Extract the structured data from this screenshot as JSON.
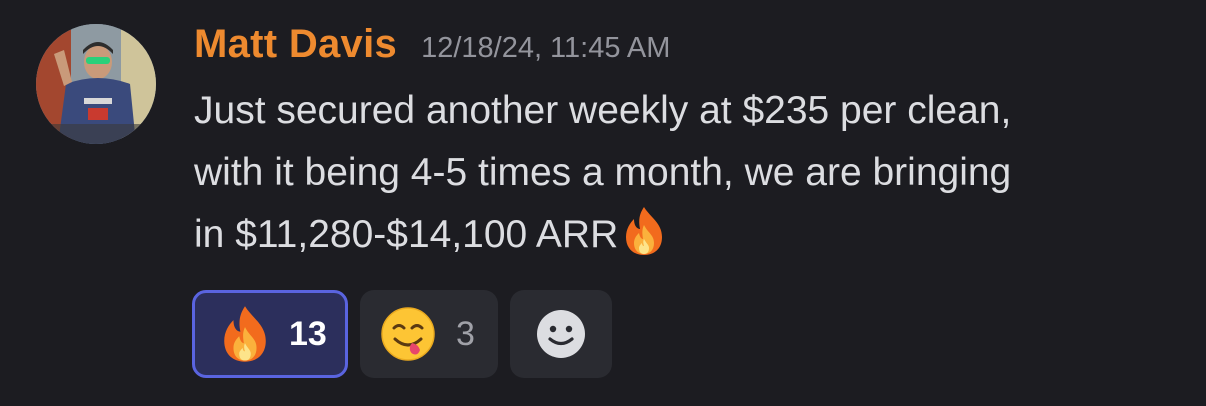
{
  "message": {
    "username": "Matt Davis",
    "timestamp": "12/18/24, 11:45 AM",
    "content_lines": [
      "Just secured another weekly at $235 per clean,",
      "with it being 4-5 times a month, we are bringing",
      "in $11,280-$14,100 ARR"
    ],
    "content_trailing_emoji": "fire-emoji",
    "avatar": "user-avatar-photo"
  },
  "reactions": [
    {
      "emoji": "fire-emoji",
      "count": "13",
      "active": true
    },
    {
      "emoji": "yum-emoji",
      "count": "3",
      "active": false
    }
  ],
  "add_reaction_icon": "add-reaction-smiley-icon",
  "colors": {
    "background": "#1c1c21",
    "username": "#ee8a2f",
    "timestamp": "#93949c",
    "text": "#dcdde1",
    "reaction_bg": "#2a2b31",
    "reaction_active_bg": "#2c2f5c",
    "reaction_active_border": "#5a64e0"
  }
}
